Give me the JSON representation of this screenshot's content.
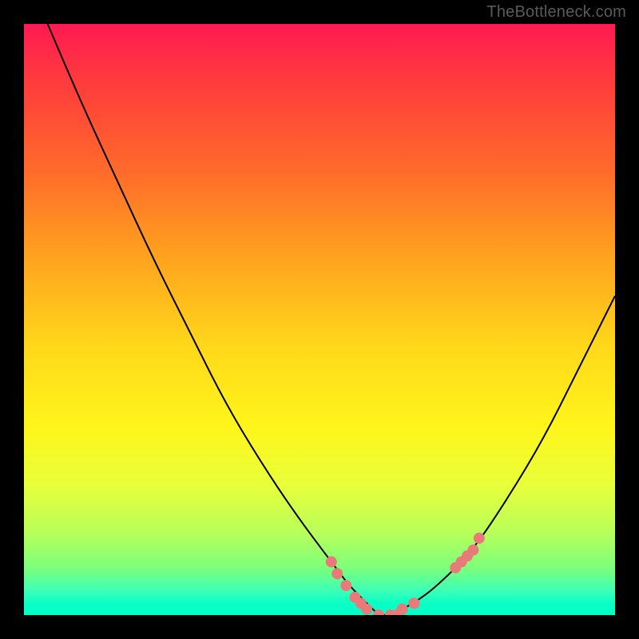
{
  "watermark": "TheBottleneck.com",
  "chart_data": {
    "type": "line",
    "title": "",
    "xlabel": "",
    "ylabel": "",
    "xlim": [
      0,
      100
    ],
    "ylim": [
      0,
      100
    ],
    "grid": false,
    "legend": false,
    "series": [
      {
        "name": "curve",
        "x": [
          4,
          10,
          16,
          22,
          28,
          34,
          40,
          46,
          52,
          55,
          58,
          60,
          62,
          66,
          70,
          76,
          82,
          88,
          94,
          100
        ],
        "y": [
          100,
          86,
          73,
          60,
          48,
          36,
          26,
          17,
          9,
          5,
          2,
          0,
          0,
          2,
          5,
          11,
          20,
          30,
          42,
          54
        ]
      }
    ],
    "markers": [
      {
        "x": 52,
        "y": 9
      },
      {
        "x": 53,
        "y": 7
      },
      {
        "x": 54.5,
        "y": 5
      },
      {
        "x": 56,
        "y": 3
      },
      {
        "x": 57,
        "y": 2
      },
      {
        "x": 58,
        "y": 1
      },
      {
        "x": 60,
        "y": 0
      },
      {
        "x": 62,
        "y": 0
      },
      {
        "x": 63,
        "y": 0
      },
      {
        "x": 64,
        "y": 1
      },
      {
        "x": 66,
        "y": 2
      },
      {
        "x": 73,
        "y": 8
      },
      {
        "x": 74,
        "y": 9
      },
      {
        "x": 75,
        "y": 10
      },
      {
        "x": 76,
        "y": 11
      },
      {
        "x": 77,
        "y": 13
      }
    ],
    "marker_style": {
      "color": "#e87a7a",
      "radius_px": 7
    }
  }
}
